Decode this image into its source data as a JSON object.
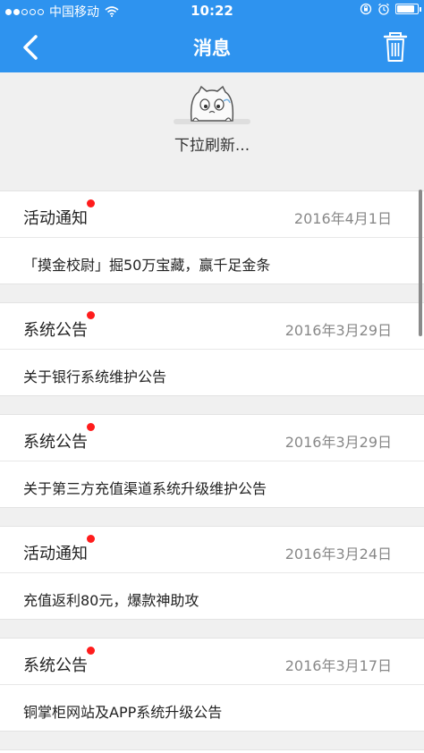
{
  "status_bar": {
    "carrier": "中国移动",
    "time": "10:22",
    "battery_level": 0.85,
    "signal_strength": 2
  },
  "nav": {
    "title": "消息"
  },
  "refresh": {
    "text": "下拉刷新..."
  },
  "colors": {
    "header": "#2e93ef",
    "unread_dot": "#ff1c1c"
  },
  "messages": [
    {
      "category": "活动通知",
      "date": "2016年4月1日",
      "content": "「摸金校尉」掘50万宝藏，赢千足金条",
      "unread": true
    },
    {
      "category": "系统公告",
      "date": "2016年3月29日",
      "content": "关于银行系统维护公告",
      "unread": true
    },
    {
      "category": "系统公告",
      "date": "2016年3月29日",
      "content": "关于第三方充值渠道系统升级维护公告",
      "unread": true
    },
    {
      "category": "活动通知",
      "date": "2016年3月24日",
      "content": "充值返利80元，爆款神助攻",
      "unread": true
    },
    {
      "category": "系统公告",
      "date": "2016年3月17日",
      "content": "铜掌柜网站及APP系统升级公告",
      "unread": true
    }
  ]
}
